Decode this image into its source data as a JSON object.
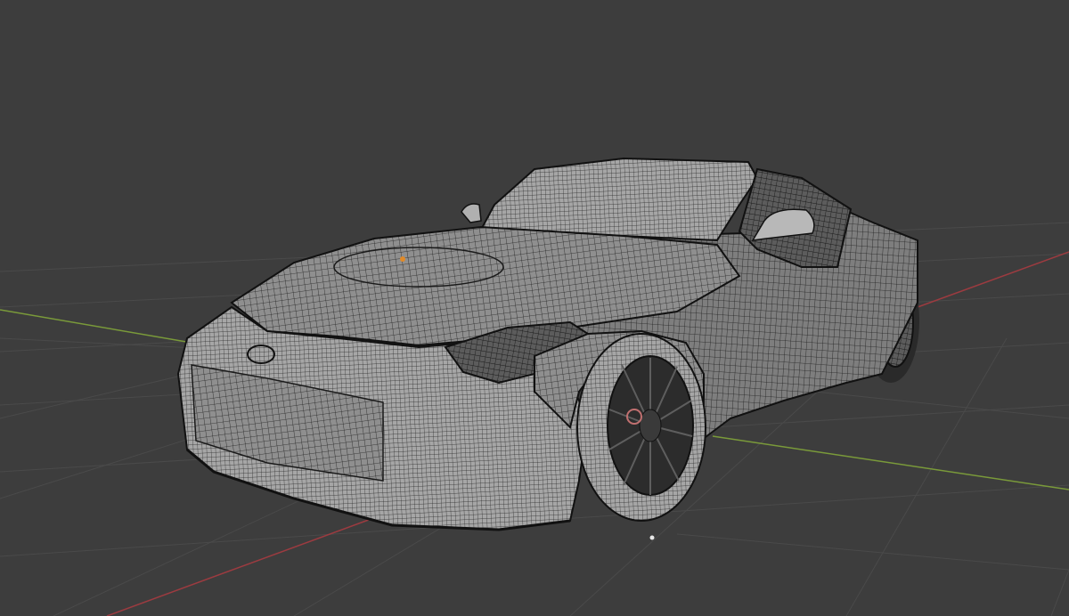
{
  "viewport": {
    "background": "#3d3d3d",
    "grid_color": "#4a4a4a",
    "axis_x_color": "#9c3b40",
    "axis_y_color": "#7a9a3a",
    "wire_color": "#1c1c1c",
    "surface_color": "#9a9a9a"
  },
  "scene": {
    "object_icon": "wireframe-sports-car",
    "view_mode": "solid-wireframe-overlay",
    "origin_marker_color": "#e08a28"
  }
}
